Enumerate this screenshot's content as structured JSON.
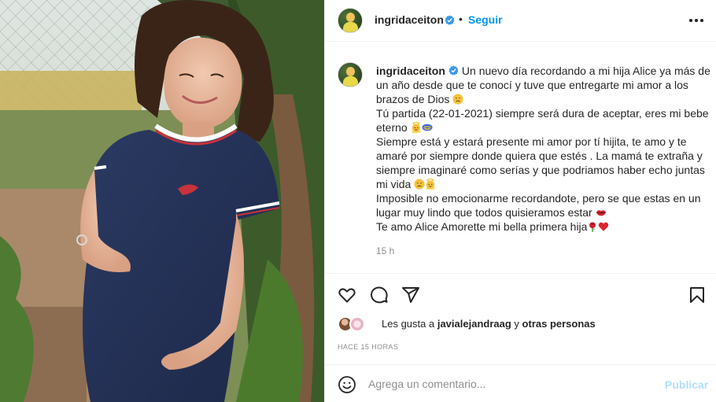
{
  "post": {
    "username": "ingridaceiton",
    "verified": true,
    "follow_label": "Seguir",
    "separator": "•",
    "more_icon": "more-horizontal-icon"
  },
  "caption": {
    "username": "ingridaceiton",
    "lines": [
      "Un nuevo día recordando a mi hija Alice ya más de",
      "un año desde que te conocí y tuve que entregarte mi amor a los",
      "brazos de Dios",
      "Tú partida (22-01-2021) siempre será dura de aceptar, eres mi bebe",
      "eterno",
      "Siempre está y estará presente mi amor por tí hijita, te amo y te",
      "amaré por siempre donde quiera que estés . La mamá te extraña y",
      "siempre imaginaré como serías y que podriamos haber echo juntas",
      "mi vida",
      "Imposible no emocionarme recordandote, pero se que estas en un",
      "lugar muy lindo que todos quisieramos estar",
      "Te amo Alice Amorette mi bella primera hija"
    ],
    "emojis": {
      "line3": [
        "disappointed-face"
      ],
      "line5": [
        "baby-angel",
        "lips"
      ],
      "line9": [
        "disappointed-face",
        "baby-angel"
      ],
      "line11": [
        "lips"
      ],
      "line12": [
        "rose",
        "red-heart"
      ]
    },
    "time": "15 h"
  },
  "actions": {
    "like_icon": "heart-icon",
    "comment_icon": "comment-icon",
    "share_icon": "paper-plane-icon",
    "save_icon": "bookmark-icon"
  },
  "likes": {
    "prefix": "Les gusta a",
    "liker": "javialejandraag",
    "connector": "y",
    "others": "otras personas"
  },
  "timestamp": "HACE 15 HORAS",
  "comment": {
    "placeholder": "Agrega un comentario...",
    "publish_label": "Publicar",
    "emoji_icon": "smiley-icon"
  },
  "colors": {
    "link_blue": "#0095f6",
    "publish_disabled": "#b2dffc",
    "text": "#262626",
    "secondary": "#8e8e8e",
    "divider": "#efefef"
  }
}
